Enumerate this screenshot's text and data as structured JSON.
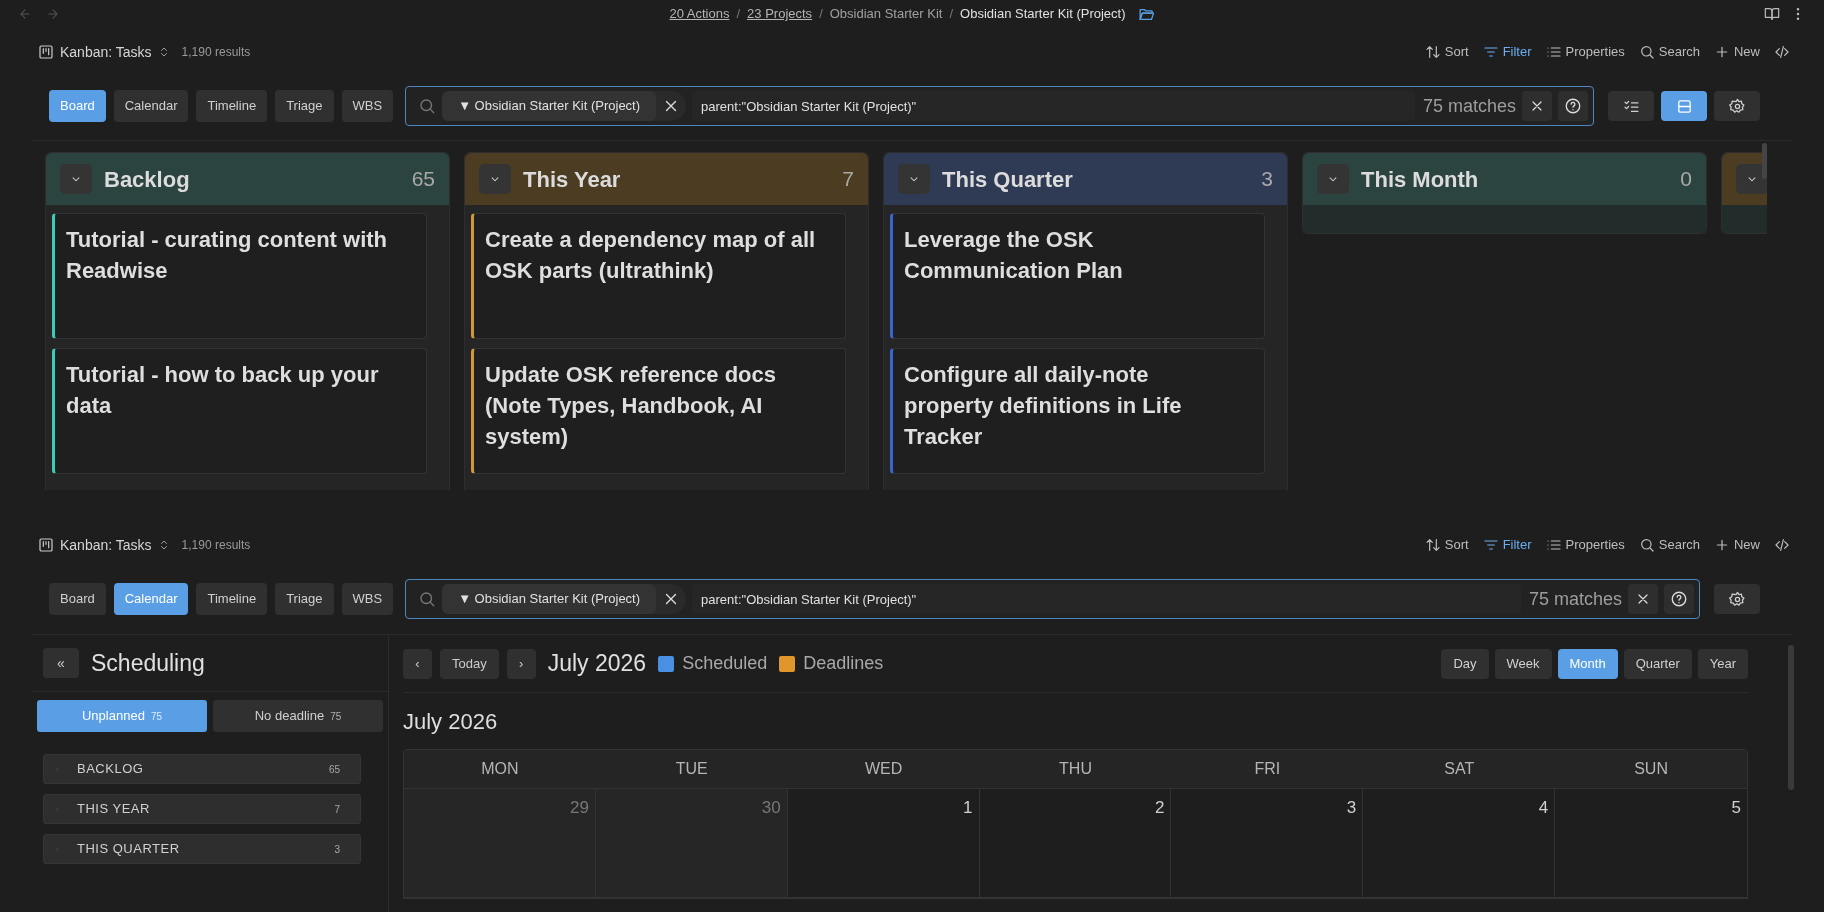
{
  "breadcrumbs": [
    {
      "label": "20 Actions",
      "kind": "link"
    },
    {
      "label": "23 Projects",
      "kind": "link",
      "separator": "/"
    },
    {
      "label": "Obsidian Starter Kit",
      "kind": "plain",
      "separator": "/"
    },
    {
      "label": "Obsidian Starter Kit (Project)",
      "kind": "current",
      "separator": "/"
    }
  ],
  "views": [
    {
      "kind": "board",
      "base": {
        "title": "Kanban: Tasks",
        "results": "1,190 results"
      },
      "actions": [
        {
          "kind": "sort",
          "label": "Sort",
          "active": false
        },
        {
          "kind": "filter",
          "label": "Filter",
          "active": true
        },
        {
          "kind": "properties",
          "label": "Properties",
          "active": false
        },
        {
          "kind": "search",
          "label": "Search",
          "active": false
        },
        {
          "kind": "new",
          "label": "New",
          "active": false
        },
        {
          "kind": "code",
          "active": false
        }
      ],
      "view_tabs": [
        {
          "label": "Board",
          "selected": true
        },
        {
          "label": "Calendar",
          "selected": false
        },
        {
          "label": "Timeline",
          "selected": false
        },
        {
          "label": "Triage",
          "selected": false
        },
        {
          "label": "WBS",
          "selected": false
        }
      ],
      "filter": {
        "chip": "▼ Obsidian Starter Kit (Project)",
        "query": "parent:\"Obsidian Starter Kit (Project)\"",
        "matches": "75 matches"
      },
      "tool_buttons": [
        {
          "kind": "checklist",
          "selected": false
        },
        {
          "kind": "layout",
          "selected": true
        },
        {
          "kind": "settings",
          "selected": false
        }
      ],
      "board": {
        "columns": [
          {
            "title": "Backlog",
            "count": "65",
            "color": "#2b4440",
            "cards": [
              "Tutorial - curating content with Readwise",
              "Tutorial - how to back up your data"
            ]
          },
          {
            "title": "This Year",
            "count": "7",
            "color": "#4b3c22",
            "cards": [
              "Create a dependency map of all OSK parts (ultrathink)",
              "Update OSK reference docs (Note Types, Handbook, AI system)"
            ]
          },
          {
            "title": "This Quarter",
            "count": "3",
            "color": "#2f3a55",
            "cards": [
              "Leverage the OSK Communication Plan",
              "Configure all daily-note property definitions in Life Tracker"
            ]
          },
          {
            "title": "This Month",
            "count": "0",
            "color": "#2b4440"
          },
          {
            "color": "#4b3c22"
          }
        ]
      }
    },
    {
      "kind": "calendar",
      "base": {
        "title": "Kanban: Tasks",
        "results": "1,190 results"
      },
      "actions": [
        {
          "kind": "sort",
          "label": "Sort",
          "active": false
        },
        {
          "kind": "filter",
          "label": "Filter",
          "active": true
        },
        {
          "kind": "properties",
          "label": "Properties",
          "active": false
        },
        {
          "kind": "search",
          "label": "Search",
          "active": false
        },
        {
          "kind": "new",
          "label": "New",
          "active": false
        },
        {
          "kind": "code",
          "active": false
        }
      ],
      "view_tabs": [
        {
          "label": "Board",
          "selected": false
        },
        {
          "label": "Calendar",
          "selected": true
        },
        {
          "label": "Timeline",
          "selected": false
        },
        {
          "label": "Triage",
          "selected": false
        },
        {
          "label": "WBS",
          "selected": false
        }
      ],
      "filter": {
        "chip": "▼ Obsidian Starter Kit (Project)",
        "query": "parent:\"Obsidian Starter Kit (Project)\"",
        "matches": "75 matches"
      },
      "tool_buttons": [
        {
          "kind": "settings",
          "selected": false
        }
      ],
      "calendar": {
        "sidebar": {
          "collapse": "«",
          "title": "Scheduling",
          "tabs": [
            {
              "label": "Unplanned",
              "count": "75",
              "selected": true
            },
            {
              "label": "No deadline",
              "count": "75",
              "selected": false
            }
          ],
          "groups": [
            {
              "label": "BACKLOG",
              "count": "65"
            },
            {
              "label": "THIS YEAR",
              "count": "7"
            },
            {
              "label": "THIS QUARTER",
              "count": "3"
            }
          ]
        },
        "prev": "‹",
        "today": "Today",
        "next": "›",
        "period": "July 2026",
        "legend": [
          {
            "label": "Scheduled",
            "color": "#4a90e2"
          },
          {
            "label": "Deadlines",
            "color": "#e0962a"
          }
        ],
        "ranges": [
          {
            "label": "Day",
            "selected": false
          },
          {
            "label": "Week",
            "selected": false
          },
          {
            "label": "Month",
            "selected": true
          },
          {
            "label": "Quarter",
            "selected": false
          },
          {
            "label": "Year",
            "selected": false
          }
        ],
        "month_title": "July 2026",
        "weekdays": [
          "MON",
          "TUE",
          "WED",
          "THU",
          "FRI",
          "SAT",
          "SUN"
        ],
        "weeks": [
          [
            {
              "day": "29",
              "outside": true
            },
            {
              "day": "30",
              "outside": true
            },
            {
              "day": "1",
              "outside": false
            },
            {
              "day": "2",
              "outside": false
            },
            {
              "day": "3",
              "outside": false
            },
            {
              "day": "4",
              "outside": false
            },
            {
              "day": "5",
              "outside": false
            }
          ]
        ]
      }
    }
  ]
}
